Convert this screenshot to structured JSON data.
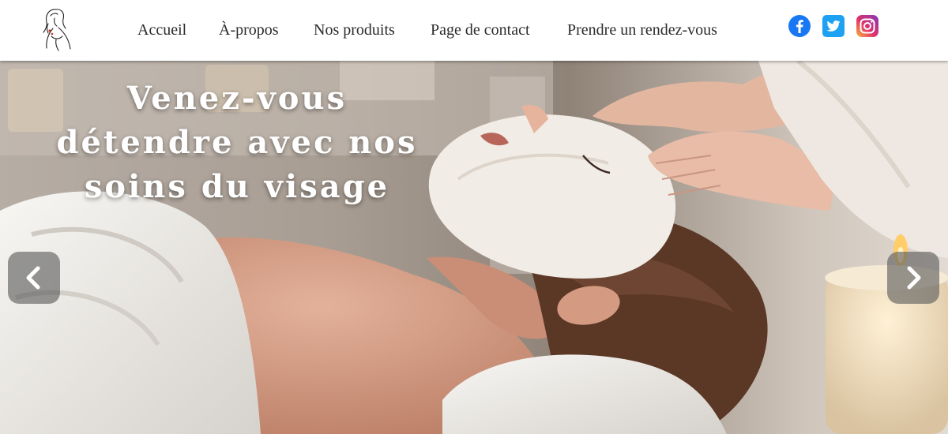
{
  "header": {
    "logo_icon": "woman-silhouette-logo-icon",
    "nav": {
      "home": "Accueil",
      "about": "À-propos",
      "products": "Nos produits",
      "contact": "Page de contact",
      "appointment": "Prendre un rendez-vous"
    },
    "social": [
      {
        "icon": "facebook-icon",
        "color": "#1877f2"
      },
      {
        "icon": "twitter-icon",
        "color": "#1da1f2"
      },
      {
        "icon": "instagram-icon",
        "color": "#d6249f"
      }
    ]
  },
  "hero": {
    "headline": "Venez-vous détendre avec nos soins du visage",
    "image": "facial-treatment-spa-photo",
    "prev_icon": "chevron-left-icon",
    "next_icon": "chevron-right-icon"
  }
}
